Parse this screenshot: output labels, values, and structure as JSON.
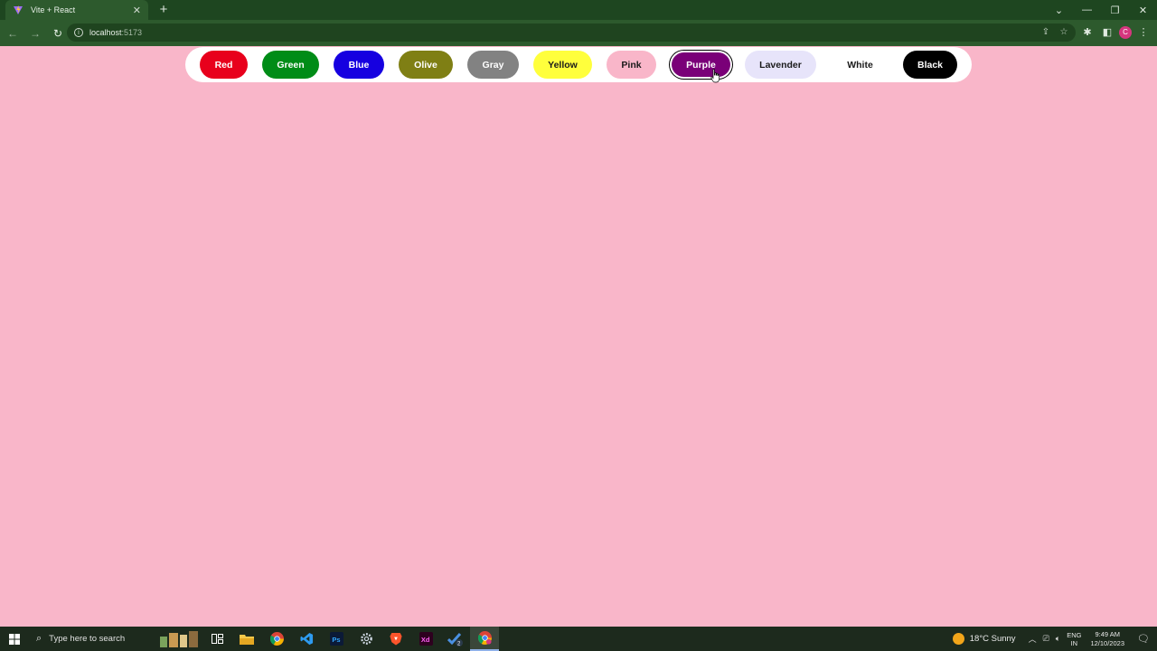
{
  "browser": {
    "tab_title": "Vite + React",
    "url_host": "localhost",
    "url_port": ":5173"
  },
  "palette": {
    "selected": "Purple",
    "page_background": "#f9b6c9",
    "buttons": [
      {
        "label": "Red",
        "bg": "#e8001c",
        "fg": "#ffffff"
      },
      {
        "label": "Green",
        "bg": "#008c17",
        "fg": "#ffffff"
      },
      {
        "label": "Blue",
        "bg": "#1600e0",
        "fg": "#ffffff"
      },
      {
        "label": "Olive",
        "bg": "#7f7f14",
        "fg": "#ffffff"
      },
      {
        "label": "Gray",
        "bg": "#828282",
        "fg": "#ffffff"
      },
      {
        "label": "Yellow",
        "bg": "#ffff3c",
        "fg": "#1a1a1a"
      },
      {
        "label": "Pink",
        "bg": "#f9b6c9",
        "fg": "#1a1a1a"
      },
      {
        "label": "Purple",
        "bg": "#7a0078",
        "fg": "#ffffff"
      },
      {
        "label": "Lavender",
        "bg": "#e7e4fa",
        "fg": "#1a1a1a"
      },
      {
        "label": "White",
        "bg": "#ffffff",
        "fg": "#1a1a1a"
      },
      {
        "label": "Black",
        "bg": "#000000",
        "fg": "#ffffff"
      }
    ]
  },
  "taskbar": {
    "search_placeholder": "Type here to search",
    "weather": "18°C  Sunny",
    "lang_line1": "ENG",
    "lang_line2": "IN",
    "time": "9:49 AM",
    "date": "12/10/2023",
    "badge": "2"
  }
}
